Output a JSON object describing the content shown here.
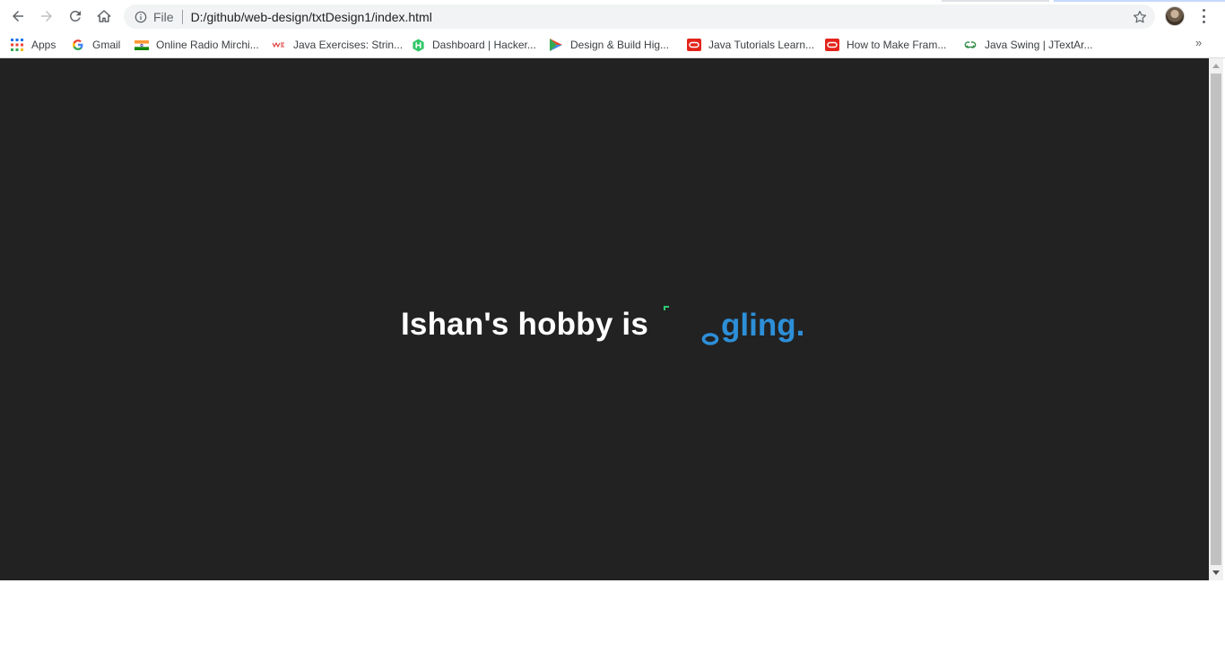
{
  "toolbar": {
    "back_icon": "arrow-left-icon",
    "forward_icon": "arrow-right-icon",
    "reload_icon": "reload-icon",
    "home_icon": "home-icon",
    "omnibox": {
      "info_icon": "info-icon",
      "scheme": "File",
      "url": "D:/github/web-design/txtDesign1/index.html",
      "star_icon": "star-icon"
    },
    "profile_icon": "avatar",
    "menu_icon": "kebab-menu-icon"
  },
  "bookmarks": [
    {
      "label": "Apps",
      "icon": "apps-grid-icon"
    },
    {
      "label": "Gmail",
      "icon": "google-g-icon"
    },
    {
      "label": "Online Radio Mirchi...",
      "icon": "india-flag-icon"
    },
    {
      "label": "Java Exercises: Strin...",
      "icon": "w3resource-icon"
    },
    {
      "label": "Dashboard | Hacker...",
      "icon": "hackerrank-icon"
    },
    {
      "label": "Design & Build Hig...",
      "icon": "google-play-icon"
    },
    {
      "label": "Java Tutorials Learn...",
      "icon": "oracle-icon"
    },
    {
      "label": "How to Make Fram...",
      "icon": "oracle-icon"
    },
    {
      "label": "Java Swing | JTextAr...",
      "icon": "geeksforgeeks-icon"
    }
  ],
  "bookmarks_more": "»",
  "page": {
    "background": "#222222",
    "static_text": "Ishan's hobby is",
    "animated_word_visible": "gling.",
    "animated_letter": "o",
    "animated_color": "#2d8fd8",
    "fragment_color": "#2ecc71"
  }
}
